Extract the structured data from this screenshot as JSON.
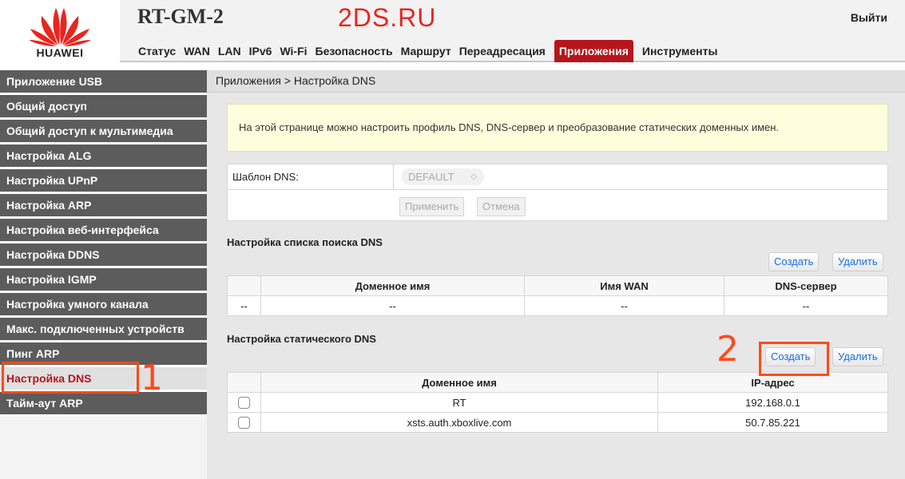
{
  "header": {
    "brand": "HUAWEI",
    "model": "RT-GM-2",
    "watermark": "2DS.RU",
    "logout_label": "Выйти",
    "brand_color": "#e8251f"
  },
  "nav": {
    "items": [
      {
        "label": "Статус",
        "active": false
      },
      {
        "label": "WAN",
        "active": false
      },
      {
        "label": "LAN",
        "active": false
      },
      {
        "label": "IPv6",
        "active": false
      },
      {
        "label": "Wi-Fi",
        "active": false
      },
      {
        "label": "Безопасность",
        "active": false
      },
      {
        "label": "Маршрут",
        "active": false
      },
      {
        "label": "Переадресация",
        "active": false
      },
      {
        "label": "Приложения",
        "active": true
      },
      {
        "label": "Инструменты",
        "active": false
      }
    ],
    "active_color": "#b6161b"
  },
  "sidebar": {
    "items": [
      {
        "label": "Приложение USB",
        "active": false
      },
      {
        "label": "Общий доступ",
        "active": false
      },
      {
        "label": "Общий доступ к мультимедиа",
        "active": false
      },
      {
        "label": "Настройка ALG",
        "active": false
      },
      {
        "label": "Настройка UPnP",
        "active": false
      },
      {
        "label": "Настройка ARP",
        "active": false
      },
      {
        "label": "Настройка веб-интерфейса",
        "active": false
      },
      {
        "label": "Настройка DDNS",
        "active": false
      },
      {
        "label": "Настройка IGMP",
        "active": false
      },
      {
        "label": "Настройка умного канала",
        "active": false
      },
      {
        "label": "Макс. подключенных устройств",
        "active": false
      },
      {
        "label": "Пинг ARP",
        "active": false
      },
      {
        "label": "Настройка DNS",
        "active": true
      },
      {
        "label": "Тайм-аут ARP",
        "active": false
      }
    ]
  },
  "main": {
    "breadcrumb": "Приложения > Настройка DNS",
    "notice": "На этой странице можно настроить профиль DNS, DNS-сервер и преобразование статических доменных имен.",
    "template_form": {
      "label": "Шаблон DNS:",
      "selected": "DEFAULT",
      "apply_label": "Применить",
      "cancel_label": "Отмена"
    },
    "search_list": {
      "title": "Настройка списка поиска DNS",
      "create_label": "Создать",
      "delete_label": "Удалить",
      "columns": [
        "",
        "Доменное имя",
        "Имя WAN",
        "DNS-сервер"
      ],
      "rows": [
        [
          "--",
          "--",
          "--",
          "--"
        ]
      ]
    },
    "static_dns": {
      "title": "Настройка статического DNS",
      "create_label": "Создать",
      "delete_label": "Удалить",
      "columns": [
        "",
        "Доменное имя",
        "IP-адрес"
      ],
      "rows": [
        {
          "domain": "RT",
          "ip": "192.168.0.1"
        },
        {
          "domain": "xsts.auth.xboxlive.com",
          "ip": "50.7.85.221"
        }
      ]
    }
  },
  "annotations": {
    "marker_1": "1",
    "marker_2": "2",
    "color": "#ff4a1c"
  }
}
